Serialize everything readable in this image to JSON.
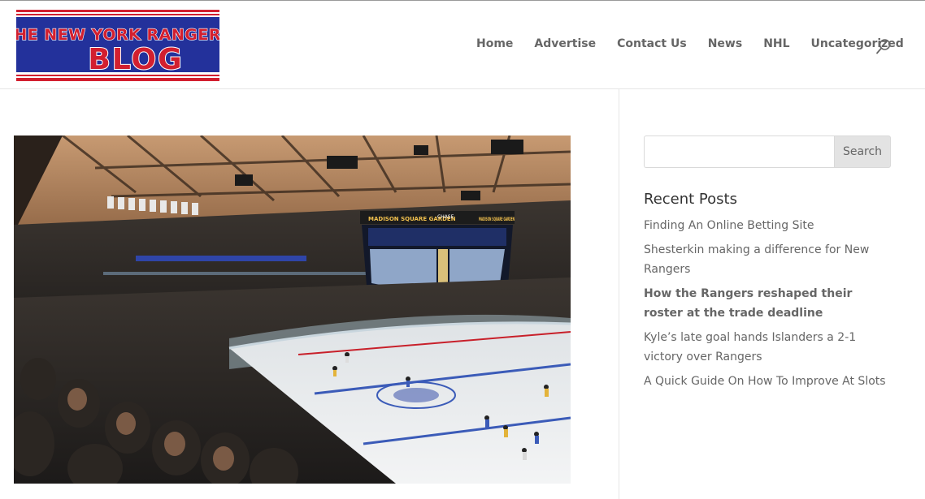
{
  "header": {
    "logo": {
      "line1": "THE NEW YORK RANGERS",
      "line2": "BLOG",
      "colors": {
        "red": "#d21f2f",
        "blue": "#23319b",
        "white": "#ffffff"
      }
    },
    "nav": [
      {
        "label": "Home"
      },
      {
        "label": "Advertise"
      },
      {
        "label": "Contact Us"
      },
      {
        "label": "News"
      },
      {
        "label": "NHL"
      },
      {
        "label": "Uncategorized"
      }
    ],
    "search_icon": "search-icon"
  },
  "main": {
    "featured_image": {
      "jumbotron_left": "MADISON SQUARE GARDEN",
      "jumbotron_center": "CHASE",
      "jumbotron_right": "MADISON SQUARE GARDEN"
    }
  },
  "sidebar": {
    "search": {
      "placeholder": "",
      "value": "",
      "button_label": "Search"
    },
    "recent_posts_title": "Recent Posts",
    "recent_posts": [
      {
        "title": "Finding An Online Betting Site",
        "bold": false
      },
      {
        "title": "Shesterkin making a difference for New Rangers",
        "bold": false
      },
      {
        "title": "How the Rangers reshaped their roster at the trade deadline",
        "bold": true
      },
      {
        "title": "Kyle’s late goal hands Islanders a 2-1 victory over Rangers",
        "bold": false
      },
      {
        "title": "A Quick Guide On How To Improve At Slots",
        "bold": false
      }
    ]
  }
}
